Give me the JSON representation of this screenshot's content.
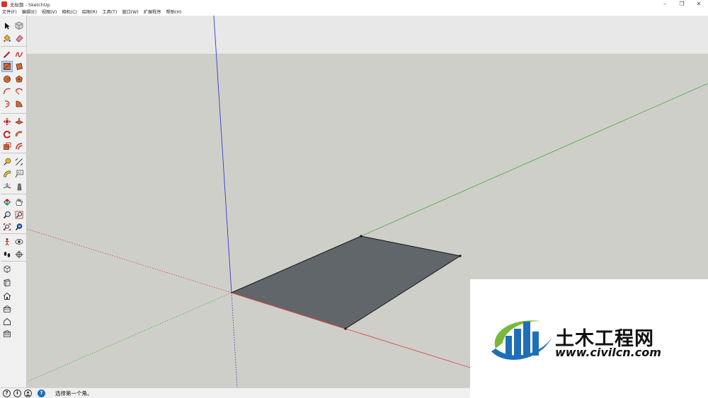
{
  "window": {
    "title": "无标题 - SketchUp"
  },
  "menubar": {
    "items": [
      "文件(F)",
      "编辑(E)",
      "视图(V)",
      "相机(C)",
      "绘图(R)",
      "工具(T)",
      "窗口(W)",
      "扩展程序",
      "帮助(H)"
    ]
  },
  "toolbar": {
    "tools": [
      "select-tool",
      "component-tool",
      "paint-bucket-tool",
      "eraser-tool",
      "line-tool",
      "freehand-tool",
      "rectangle-tool",
      "rotated-rectangle-tool",
      "circle-tool",
      "polygon-tool",
      "arc-tool",
      "two-point-arc-tool",
      "three-point-arc-tool",
      "pie-tool",
      "move-tool",
      "push-pull-tool",
      "rotate-tool",
      "follow-me-tool",
      "scale-tool",
      "offset-tool",
      "tape-measure-tool",
      "dimension-tool",
      "protractor-tool",
      "text-tool",
      "axes-tool",
      "3d-text-tool",
      "orbit-tool",
      "pan-tool",
      "zoom-tool",
      "zoom-window-tool",
      "zoom-extents-tool",
      "previous-view-tool",
      "position-camera-tool",
      "look-around-tool",
      "walk-tool",
      "section-plane-tool",
      "warehouse-tool",
      "extension-warehouse-tool",
      "house-tool",
      "share-model-tool",
      "outliner-tool",
      "preview-tool"
    ],
    "active_tool": "rectangle-tool"
  },
  "colors": {
    "sky": "#e8e8e8",
    "ground": "#cfcfc9",
    "face": "#61666b",
    "red_axis": "#d94a4a",
    "green_axis": "#4caf4c",
    "blue_axis": "#3a3acd",
    "brand_blue": "#1f6fb8",
    "brand_green": "#7ab83a"
  },
  "statusbar": {
    "icons": [
      "geo-location-icon",
      "info-icon",
      "user-icon",
      "help-icon"
    ],
    "message": "选择第一个角。"
  },
  "watermark": {
    "title": "土木工程网",
    "url": "www.civilcn.com"
  }
}
